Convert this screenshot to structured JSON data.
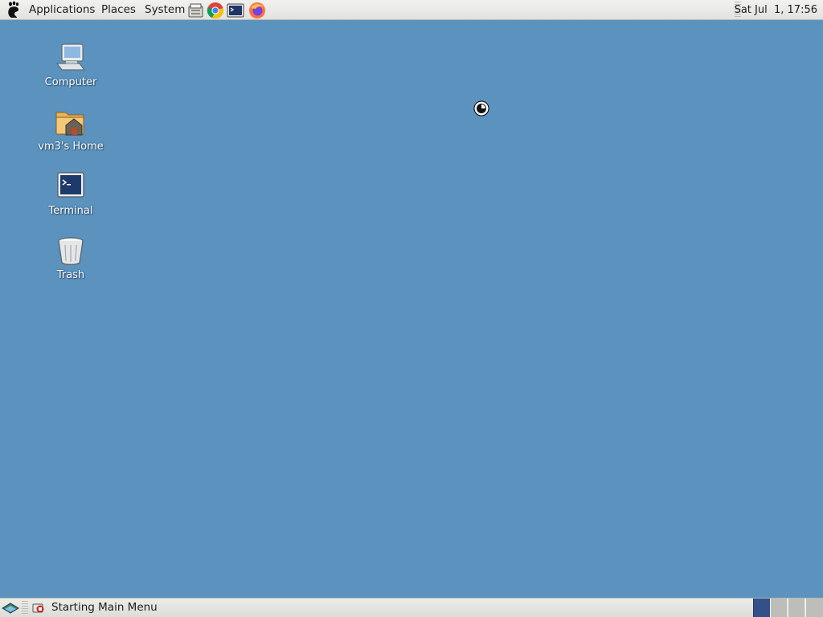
{
  "top_panel": {
    "menus": {
      "applications": "Applications",
      "places": "Places",
      "system": "System"
    },
    "launchers": [
      "file-manager-icon",
      "chrome-icon",
      "terminal-icon",
      "firefox-icon"
    ],
    "clock": "Sat Jul  1, 17:56"
  },
  "desktop": {
    "background_color": "#5b92be",
    "icons": [
      {
        "label": "Computer",
        "icon": "computer-icon"
      },
      {
        "label": "vm3's Home",
        "icon": "home-folder-icon"
      },
      {
        "label": "Terminal",
        "icon": "terminal-icon"
      },
      {
        "label": "Trash",
        "icon": "trash-icon"
      }
    ]
  },
  "bottom_panel": {
    "taskbar_item": "Starting Main Menu",
    "workspaces": {
      "count": 4,
      "active": 1
    }
  }
}
